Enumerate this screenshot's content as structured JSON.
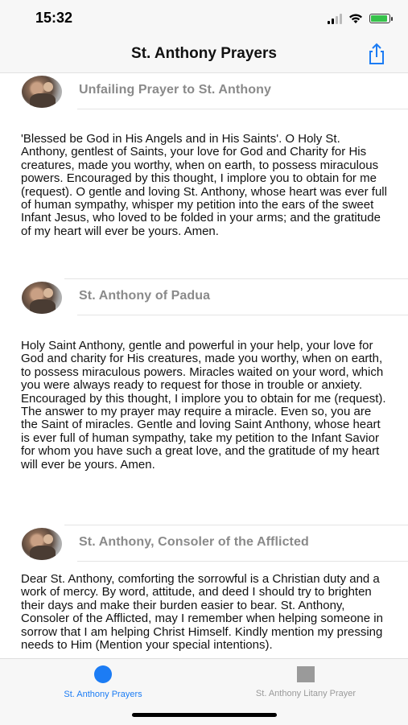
{
  "status_bar": {
    "time": "15:32",
    "battery_level": 0.9
  },
  "nav": {
    "title": "St. Anthony Prayers",
    "share_icon": "share-icon"
  },
  "sections": [
    {
      "title": "Unfailing Prayer to St. Anthony",
      "text": "'Blessed be God in His Angels and in His Saints'. O Holy St. Anthony, gentlest of Saints, your love for God and Charity for His creatures, made you worthy, when on earth, to possess miraculous powers. Encouraged by this thought, I implore you to obtain for me (request). O gentle and loving St. Anthony, whose heart was ever full of human sympathy, whisper my petition into the ears of the sweet Infant Jesus, who loved to be folded in your arms; and the gratitude of my heart will ever be yours. Amen."
    },
    {
      "title": "St. Anthony of Padua",
      "text": "Holy Saint Anthony, gentle and powerful in your help, your love for God and charity for His creatures, made you worthy, when on earth, to possess miraculous powers. Miracles waited on your word, which you were always ready to request for those in trouble or anxiety. Encouraged by this thought, I implore you to obtain for me (request). The answer to my prayer may require a miracle. Even so, you are the Saint of miracles. Gentle and loving Saint Anthony, whose heart is ever full of human sympathy, take my petition to the Infant Savior for whom you have such a great love, and the gratitude of my heart will ever be yours. Amen."
    },
    {
      "title": "St. Anthony, Consoler of the Afflicted",
      "text": "Dear St. Anthony, comforting the sorrowful is a Christian duty and a work of mercy. By word, attitude, and deed I should try to brighten their days and make their burden easier to bear. St. Anthony, Consoler of the Afflicted, may I remember when helping someone in sorrow that I am helping Christ Himself. Kindly mention my pressing needs to Him (Mention your special intentions)."
    }
  ],
  "tabs": [
    {
      "label": "St. Anthony Prayers",
      "icon": "circle-icon",
      "active": true,
      "color": "#1c7cf4"
    },
    {
      "label": "St. Anthony Litany Prayer",
      "icon": "square-icon",
      "active": false,
      "color": "#9a9a9a"
    }
  ]
}
